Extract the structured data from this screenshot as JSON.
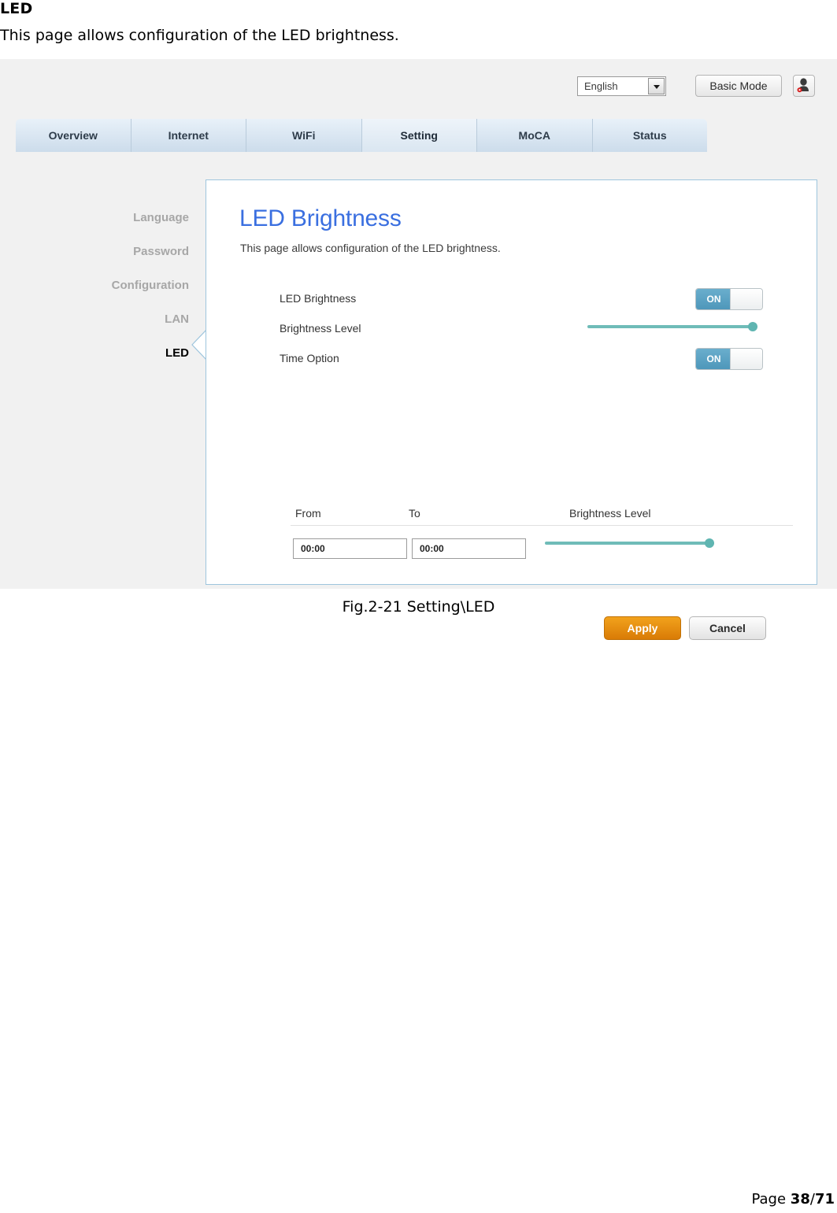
{
  "document": {
    "heading": "LED",
    "intro": "This page allows configuration of the LED brightness.",
    "figure_caption": "Fig.2-21 Setting\\LED",
    "footer": {
      "label": "Page",
      "current_page": "38",
      "separator": "/",
      "total_pages": "71"
    }
  },
  "screenshot": {
    "topbar": {
      "language_value": "English",
      "language_icon": "chevron-down-icon",
      "mode_button": "Basic Mode",
      "user_icon": "user-account-icon"
    },
    "tabs": [
      {
        "label": "Overview",
        "active": false
      },
      {
        "label": "Internet",
        "active": false
      },
      {
        "label": "WiFi",
        "active": false
      },
      {
        "label": "Setting",
        "active": true
      },
      {
        "label": "MoCA",
        "active": false
      },
      {
        "label": "Status",
        "active": false
      }
    ],
    "sidebar": [
      {
        "label": "Language",
        "active": false
      },
      {
        "label": "Password",
        "active": false
      },
      {
        "label": "Configuration",
        "active": false
      },
      {
        "label": "LAN",
        "active": false
      },
      {
        "label": "LED",
        "active": true
      }
    ],
    "panel": {
      "title": "LED Brightness",
      "subtitle": "This page allows configuration of the LED brightness.",
      "fields": {
        "led_brightness_label": "LED Brightness",
        "led_brightness_toggle": "ON",
        "brightness_level_label": "Brightness Level",
        "time_option_label": "Time Option",
        "time_option_toggle": "ON"
      },
      "schedule_table": {
        "headers": [
          "From",
          "To",
          "Brightness Level"
        ],
        "row": {
          "from": "00:00",
          "to": "00:00"
        }
      },
      "buttons": {
        "apply": "Apply",
        "cancel": "Cancel"
      }
    },
    "colors": {
      "page_background": "#f1f1f1",
      "panel_border": "#9ec5dd",
      "title_blue": "#3a6fe0",
      "toggle_on": "#4e97ba",
      "slider_teal": "#6fbcb8",
      "apply_orange": "#d97b06"
    }
  }
}
